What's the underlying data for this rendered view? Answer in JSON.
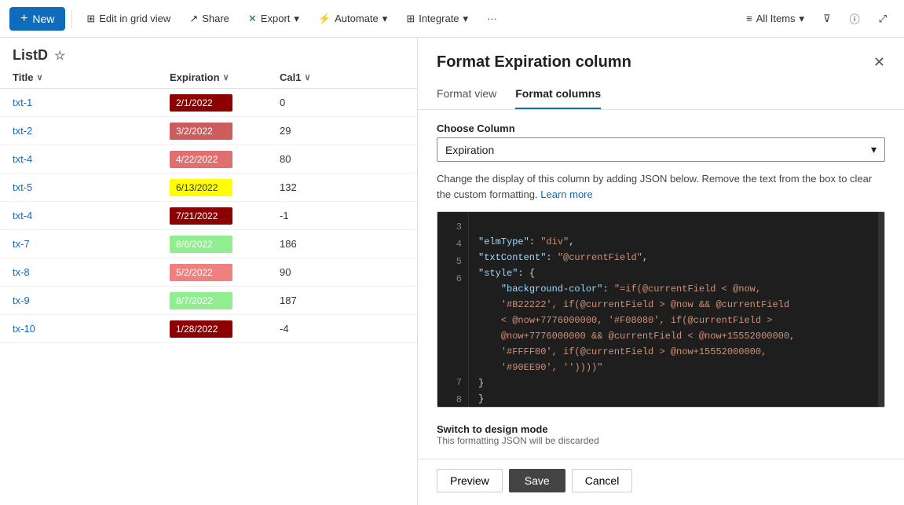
{
  "toolbar": {
    "new_label": "New",
    "edit_grid_label": "Edit in grid view",
    "share_label": "Share",
    "export_label": "Export",
    "automate_label": "Automate",
    "integrate_label": "Integrate",
    "more_label": "···",
    "all_items_label": "All Items"
  },
  "list": {
    "title": "ListD",
    "columns": {
      "title": "Title",
      "expiration": "Expiration",
      "cal1": "Cal1"
    },
    "rows": [
      {
        "title": "txt-1",
        "expiration": "2/1/2022",
        "cal1": "0",
        "color": "#8B0000"
      },
      {
        "title": "txt-2",
        "expiration": "3/2/2022",
        "cal1": "29",
        "color": "#cd5c5c"
      },
      {
        "title": "txt-4",
        "expiration": "4/22/2022",
        "cal1": "80",
        "color": "#e07070"
      },
      {
        "title": "txt-5",
        "expiration": "6/13/2022",
        "cal1": "132",
        "color": "#FFFF00"
      },
      {
        "title": "txt-4",
        "expiration": "7/21/2022",
        "cal1": "-1",
        "color": "#8B0000"
      },
      {
        "title": "tx-7",
        "expiration": "8/6/2022",
        "cal1": "186",
        "color": "#90EE90"
      },
      {
        "title": "tx-8",
        "expiration": "5/2/2022",
        "cal1": "90",
        "color": "#F08080"
      },
      {
        "title": "tx-9",
        "expiration": "8/7/2022",
        "cal1": "187",
        "color": "#90EE90"
      },
      {
        "title": "tx-10",
        "expiration": "1/28/2022",
        "cal1": "-4",
        "color": "#8B0000"
      }
    ]
  },
  "panel": {
    "title": "Format Expiration column",
    "tab_format_view": "Format view",
    "tab_format_columns": "Format columns",
    "choose_column_label": "Choose Column",
    "selected_column": "Expiration",
    "description": "Change the display of this column by adding JSON below. Remove the text from the box to clear the custom formatting.",
    "learn_more": "Learn more",
    "code_lines": [
      {
        "num": "3",
        "content": "    \"elmType\": \"div\","
      },
      {
        "num": "4",
        "content": "    \"txtContent\": \"@currentField\","
      },
      {
        "num": "5",
        "content": "    \"style\": {"
      },
      {
        "num": "6",
        "content": "        \"background-color\": \"=if(@currentField < @now,\n        '#B22222', if(@currentField > @now && @currentField\n        < @now+7776000000, '#F08080', if(@currentField >\n        @now+7776000000 && @currentField < @now+15552000000,\n        '#FFFF00', if(@currentField > @now+15552000000,\n        '#90EE90', ''))))"
      },
      {
        "num": "7",
        "content": "    }"
      },
      {
        "num": "8",
        "content": "}"
      }
    ],
    "design_mode_label": "Switch to design mode",
    "design_mode_sub": "This formatting JSON will be discarded",
    "btn_preview": "Preview",
    "btn_save": "Save",
    "btn_cancel": "Cancel"
  }
}
